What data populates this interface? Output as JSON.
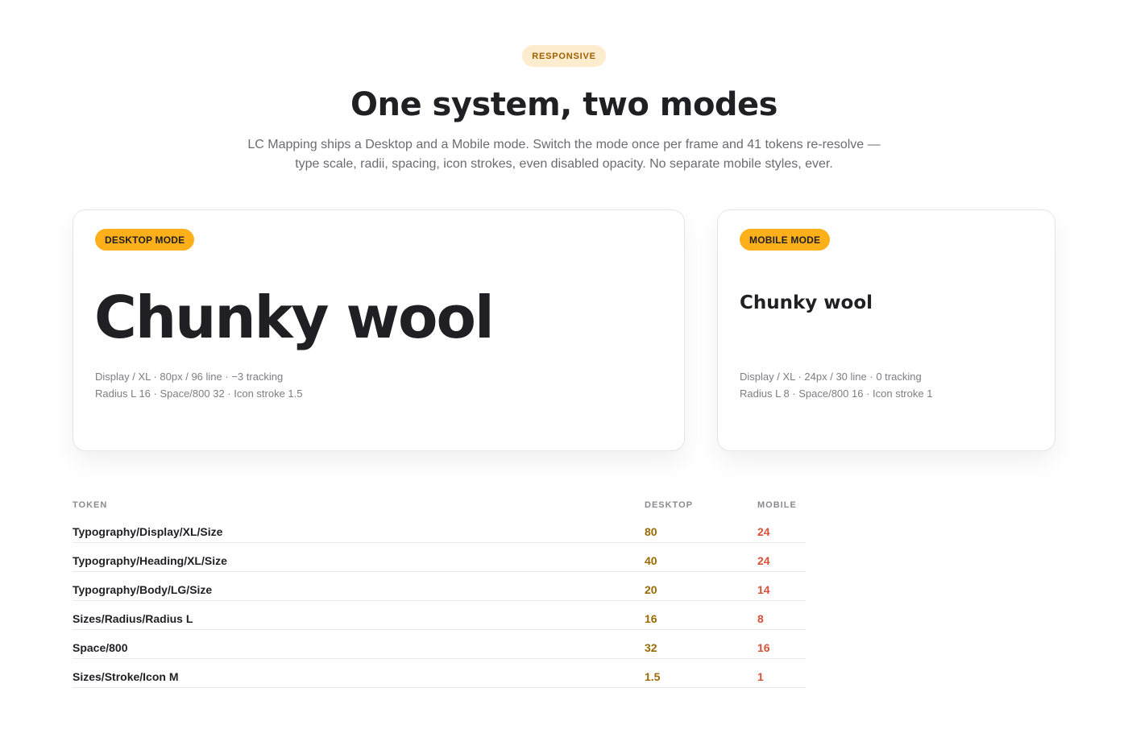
{
  "header": {
    "eyebrow": "RESPONSIVE",
    "title": "One system, two modes",
    "subtitle_line1": "LC Mapping ships a Desktop and a Mobile mode. Switch the mode once per frame and 41 tokens re-resolve —",
    "subtitle_line2": "type scale, radii, spacing, icon strokes, even disabled opacity. No separate mobile styles, ever."
  },
  "cards": {
    "desktop": {
      "badge": "DESKTOP MODE",
      "sample": "Chunky wool",
      "spec_line1": "Display / XL · 80px / 96 line · −3 tracking",
      "spec_line2": "Radius L 16 · Space/800 32 · Icon stroke 1.5"
    },
    "mobile": {
      "badge": "MOBILE MODE",
      "sample": "Chunky wool",
      "spec_line1": "Display / XL · 24px / 30 line · 0 tracking",
      "spec_line2": "Radius L 8 · Space/800 16 · Icon stroke 1"
    }
  },
  "table": {
    "columns": {
      "token": "TOKEN",
      "desktop": "DESKTOP",
      "mobile": "MOBILE"
    },
    "rows": [
      {
        "token": "Typography/Display/XL/Size",
        "desktop": "80",
        "mobile": "24"
      },
      {
        "token": "Typography/Heading/XL/Size",
        "desktop": "40",
        "mobile": "24"
      },
      {
        "token": "Typography/Body/LG/Size",
        "desktop": "20",
        "mobile": "14"
      },
      {
        "token": "Sizes/Radius/Radius L",
        "desktop": "16",
        "mobile": "8"
      },
      {
        "token": "Space/800",
        "desktop": "32",
        "mobile": "16"
      },
      {
        "token": "Sizes/Stroke/Icon M",
        "desktop": "1.5",
        "mobile": "1"
      }
    ]
  },
  "colors": {
    "accent": "#fdb01a",
    "eyebrow_bg": "#fdeccd",
    "desktop_value": "#9a6a00",
    "mobile_value": "#d9503a"
  }
}
